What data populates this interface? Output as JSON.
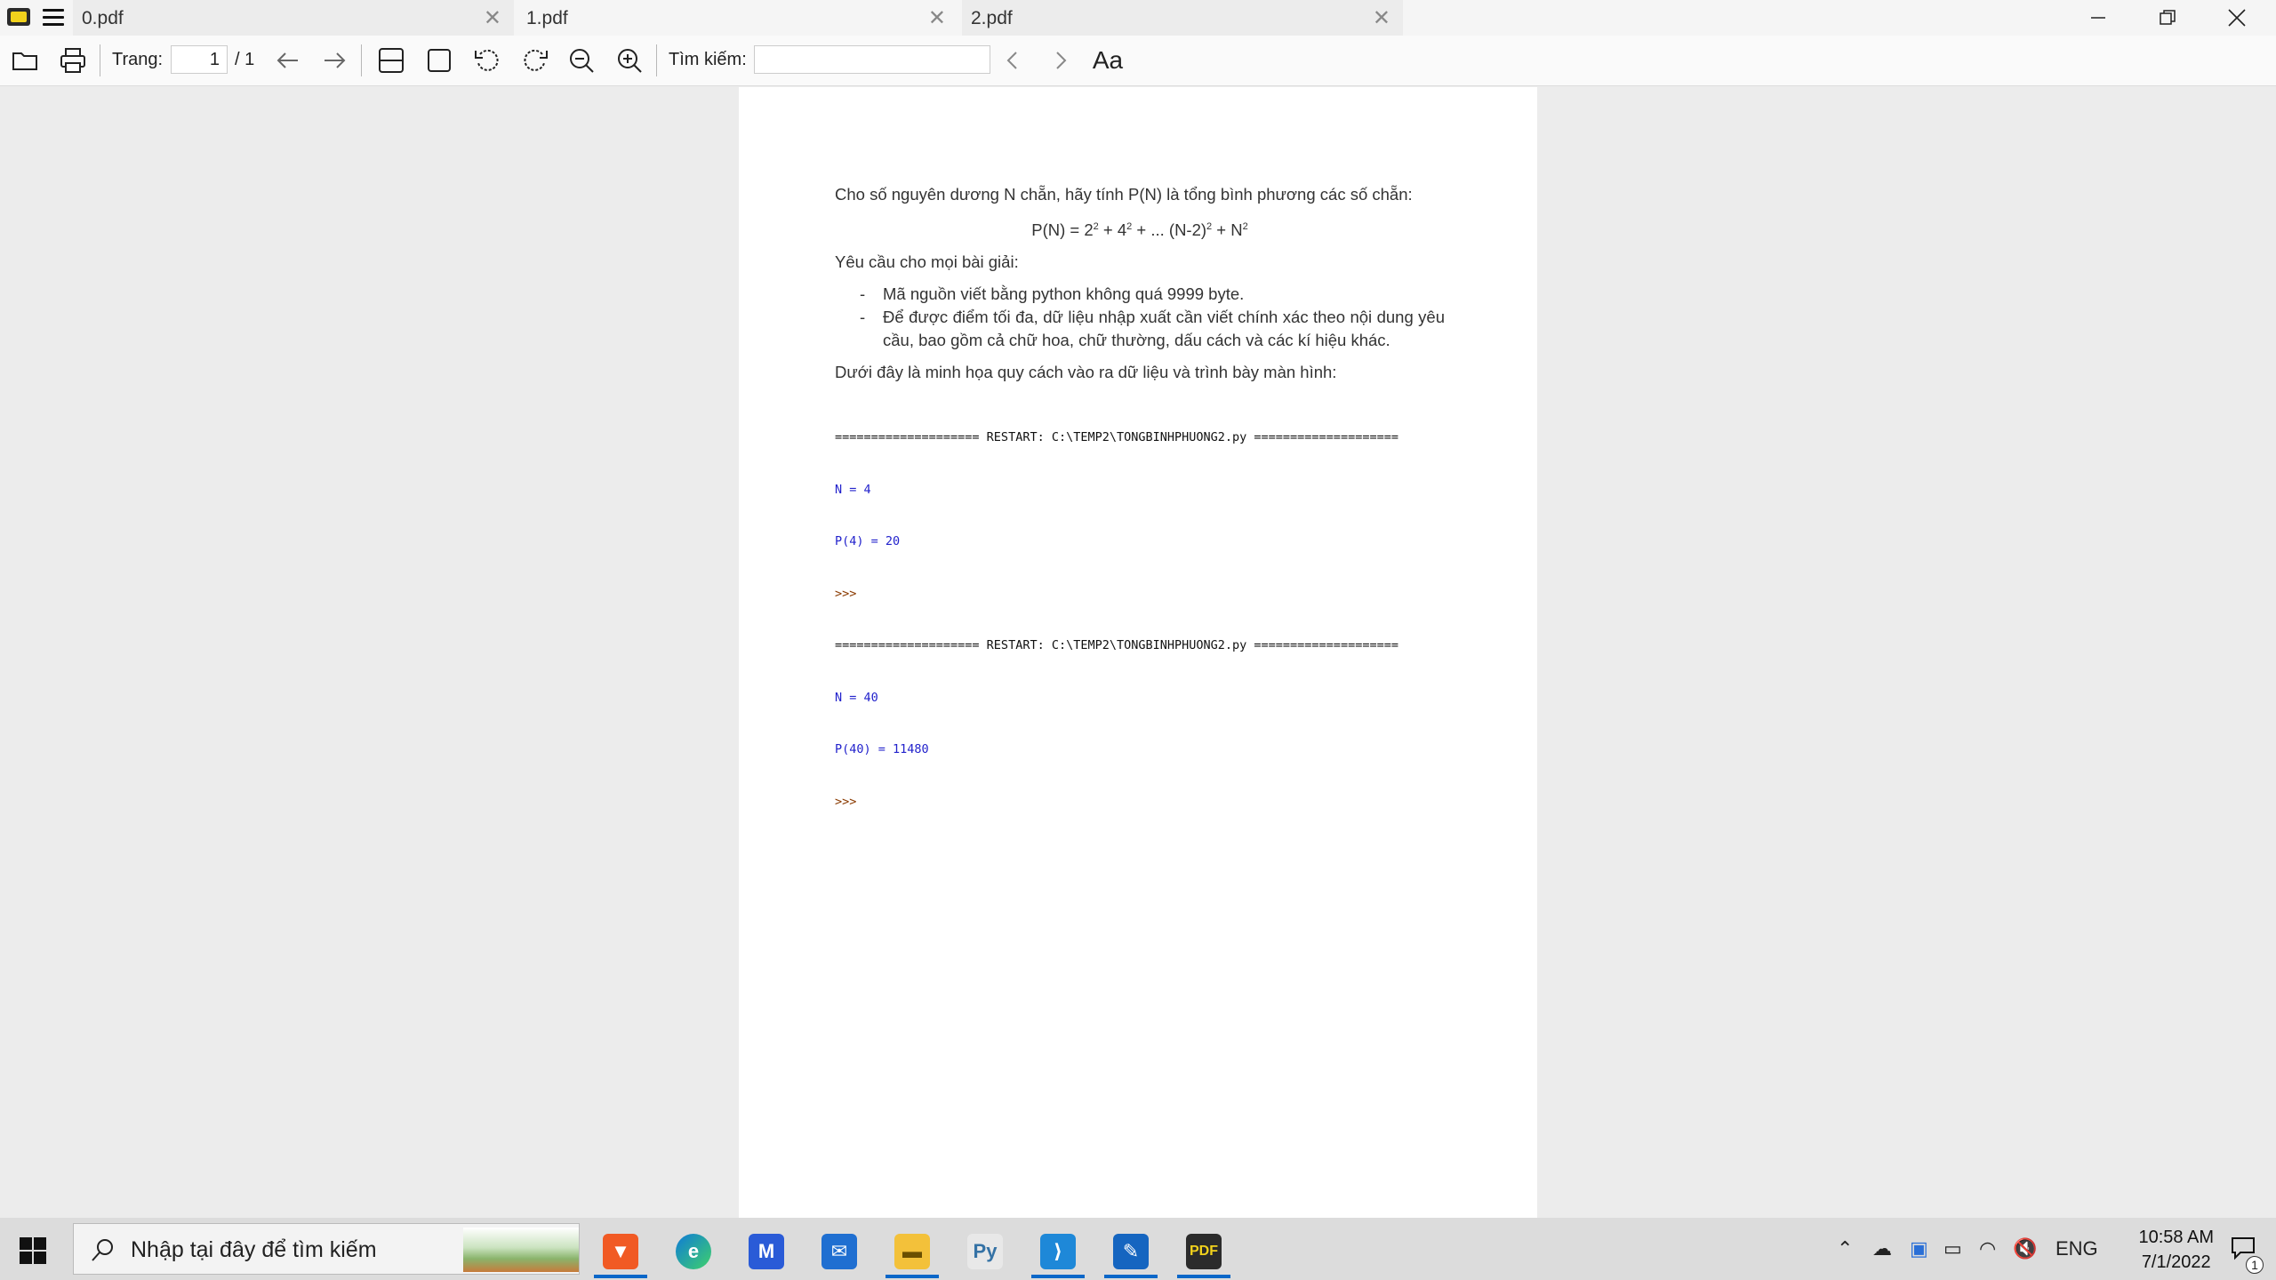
{
  "tabs": [
    {
      "label": "0.pdf",
      "active": false
    },
    {
      "label": "1.pdf",
      "active": true
    },
    {
      "label": "2.pdf",
      "active": false
    }
  ],
  "toolbar": {
    "page_label": "Trang:",
    "page_current": "1",
    "page_total": "/ 1",
    "search_label": "Tìm kiếm:",
    "search_value": "",
    "font_glyph": "Aa"
  },
  "document": {
    "intro": "Cho số nguyên dương N chẵn, hãy tính P(N) là tổng bình phương các số chẵn:",
    "formula": {
      "lhs": "P(N) = 2",
      "e1": "2",
      "p2": " + 4",
      "e2": "2",
      "p3": " + ... (N-2)",
      "e3": "2",
      "p4": " + N",
      "e4": "2"
    },
    "requirements_heading": "Yêu cầu cho mọi bài giải:",
    "bullets": [
      "Mã nguồn viết bằng python không quá 9999 byte.",
      "Để được điểm tối đa, dữ liệu nhập xuất cần viết chính xác theo nội dung yêu cầu, bao gồm cả chữ hoa, chữ thường, dấu cách và các kí hiệu khác."
    ],
    "example_heading": "Dưới đây là minh họa quy cách vào ra dữ liệu và trình bày màn hình:",
    "console": [
      {
        "text": "==================== RESTART: C:\\TEMP2\\TONGBINHPHUONG2.py ====================",
        "color": "black"
      },
      {
        "text": "N = 4",
        "color": "blue"
      },
      {
        "text": "P(4) = 20",
        "color": "blue"
      },
      {
        "text": ">>>",
        "color": "brown"
      },
      {
        "text": "==================== RESTART: C:\\TEMP2\\TONGBINHPHUONG2.py ====================",
        "color": "black"
      },
      {
        "text": "N = 40",
        "color": "blue"
      },
      {
        "text": "P(40) = 11480",
        "color": "blue"
      },
      {
        "text": ">>>",
        "color": "brown"
      }
    ]
  },
  "taskbar": {
    "search_placeholder": "Nhập tại đây để tìm kiếm",
    "language": "ENG",
    "time": "10:58 AM",
    "date": "7/1/2022",
    "notification_count": "1"
  }
}
